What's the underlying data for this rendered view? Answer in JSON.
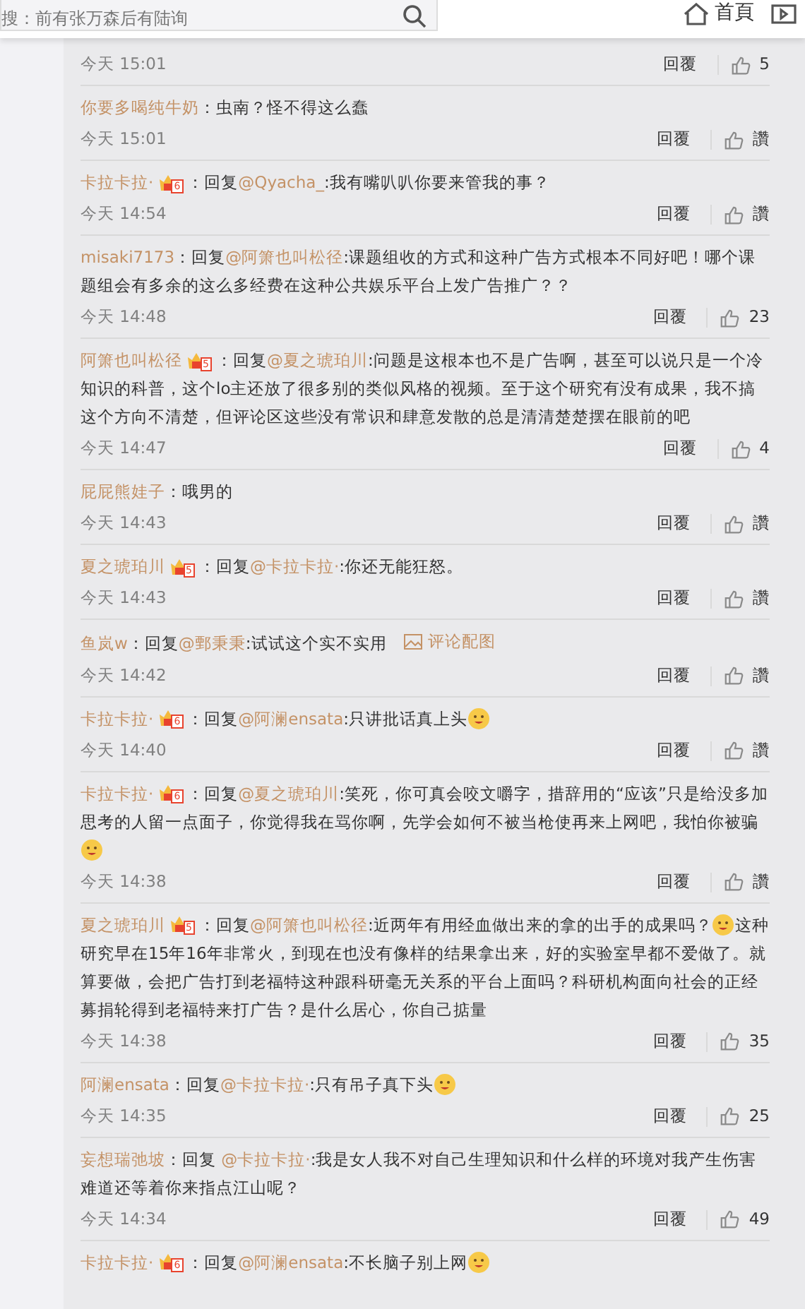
{
  "header": {
    "search": {
      "placeholder": "搜：前有张万森后有陆询"
    },
    "nav": [
      "首頁"
    ]
  },
  "top_comment": {
    "time": "今天 15:01",
    "reply": "回覆",
    "likes": "5"
  },
  "comments": [
    {
      "author": "你要多喝纯牛奶",
      "prefix": "：",
      "text": "虫南？怪不得这么蠢",
      "time": "今天 15:01",
      "reply": "回覆",
      "likes": "讚"
    },
    {
      "author": "卡拉卡拉·",
      "badge": "6",
      "prefix": "：回复",
      "mention": "@Qyacha_",
      "text": ":我有嘴叭叭你要来管我的事？",
      "time": "今天 14:54",
      "reply": "回覆",
      "likes": "讚"
    },
    {
      "author": "misaki7173",
      "prefix": "：回复",
      "mention": "@阿箫也叫松径",
      "text": ":课题组收的方式和这种广告方式根本不同好吧！哪个课题组会有多余的这么多经费在这种公共娱乐平台上发广告推广？？",
      "time": "今天 14:48",
      "reply": "回覆",
      "likes": "23"
    },
    {
      "author": "阿箫也叫松径",
      "badge": "5",
      "prefix": "：回复",
      "mention": "@夏之琥珀川",
      "text": ":问题是这根本也不是广告啊，甚至可以说只是一个冷知识的科普，这个lo主还放了很多别的类似风格的视频。至于这个研究有没有成果，我不搞这个方向不清楚，但评论区这些没有常识和肆意发散的总是清清楚楚摆在眼前的吧",
      "time": "今天 14:47",
      "reply": "回覆",
      "likes": "4"
    },
    {
      "author": "屁屁熊娃子",
      "prefix": "：",
      "text": "哦男的",
      "time": "今天 14:43",
      "reply": "回覆",
      "likes": "讚"
    },
    {
      "author": "夏之琥珀川",
      "badge": "5",
      "prefix": "：回复",
      "mention": "@卡拉卡拉·",
      "text": ":你还无能狂怒。",
      "time": "今天 14:43",
      "reply": "回覆",
      "likes": "讚"
    },
    {
      "author": "鱼岚w",
      "prefix": "：回复",
      "mention": "@鄄秉秉",
      "text": ":试试这个实不实用",
      "image_link": "评论配图",
      "time": "今天 14:42",
      "reply": "回覆",
      "likes": "讚"
    },
    {
      "author": "卡拉卡拉·",
      "badge": "6",
      "prefix": "：回复",
      "mention": "@阿澜ensata",
      "text": ":只讲批话真上头",
      "emoji": true,
      "time": "今天 14:40",
      "reply": "回覆",
      "likes": "讚"
    },
    {
      "author": "卡拉卡拉·",
      "badge": "6",
      "prefix": "：回复",
      "mention": "@夏之琥珀川",
      "text": ":笑死，你可真会咬文嚼字，措辞用的“应该”只是给没多加思考的人留一点面子，你觉得我在骂你啊，先学会如何不被当枪使再来上网吧，我怕你被骗",
      "emoji": true,
      "time": "今天 14:38",
      "reply": "回覆",
      "likes": "讚"
    },
    {
      "author": "夏之琥珀川",
      "badge": "5",
      "prefix": "：回复",
      "mention": "@阿箫也叫松径",
      "text": ":近两年有用经血做出来的拿的出手的成果吗？",
      "emoji": true,
      "text_after": "这种研究早在15年16年非常火，到现在也没有像样的结果拿出来，好的实验室早都不爱做了。就算要做，会把广告打到老福特这种跟科研毫无关系的平台上面吗？科研机构面向社会的正经募捐轮得到老福特来打广告？是什么居心，你自己掂量",
      "time": "今天 14:38",
      "reply": "回覆",
      "likes": "35"
    },
    {
      "author": "阿澜ensata",
      "prefix": "：回复",
      "mention": "@卡拉卡拉·",
      "text": ":只有吊子真下头",
      "emoji": true,
      "time": "今天 14:35",
      "reply": "回覆",
      "likes": "25"
    },
    {
      "author": "妄想瑞弛坡",
      "prefix": "：回复 ",
      "mention": "@卡拉卡拉·",
      "text": ":我是女人我不对自己生理知识和什么样的环境对我产生伤害难道还等着你来指点江山呢？",
      "time": "今天 14:34",
      "reply": "回覆",
      "likes": "49"
    },
    {
      "author": "卡拉卡拉·",
      "badge": "6",
      "prefix": "：回复",
      "mention": "@阿澜ensata",
      "text": ":不长脑子别上网",
      "emoji": true
    }
  ]
}
